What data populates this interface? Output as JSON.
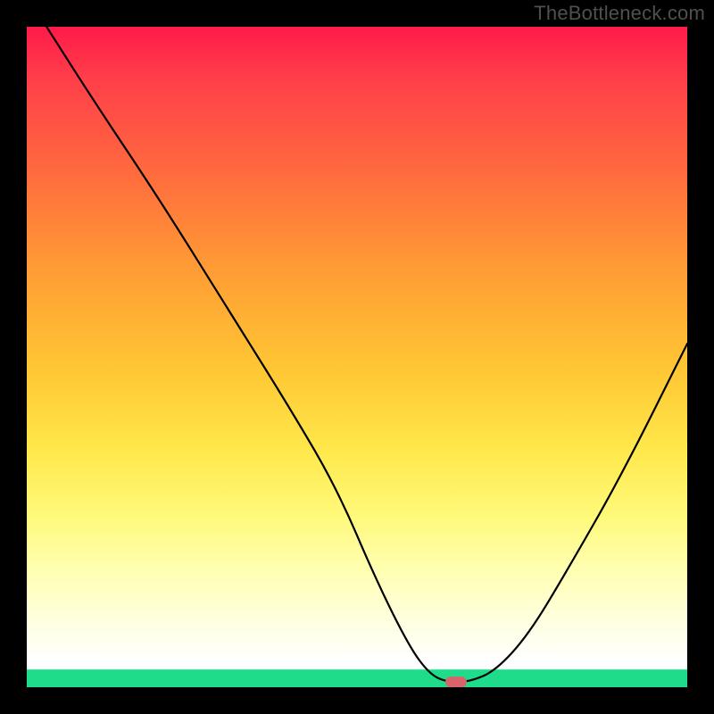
{
  "watermark": "TheBottleneck.com",
  "chart_data": {
    "type": "line",
    "title": "",
    "xlabel": "",
    "ylabel": "",
    "xlim": [
      0,
      100
    ],
    "ylim": [
      0,
      100
    ],
    "series": [
      {
        "name": "bottleneck-curve",
        "x": [
          3,
          10,
          20,
          30,
          40,
          47,
          53,
          58,
          61,
          63.5,
          67,
          71,
          76,
          82,
          90,
          100
        ],
        "y": [
          100,
          89,
          74,
          58,
          42,
          30,
          16,
          6,
          2,
          0.8,
          0.8,
          2.5,
          8,
          18,
          32,
          52
        ]
      }
    ],
    "marker": {
      "x": 65,
      "y": 0.8,
      "color": "#d9636b"
    },
    "gradient_stops": [
      {
        "pct": 0,
        "color": "#ff1a4a"
      },
      {
        "pct": 50,
        "color": "#ffd040"
      },
      {
        "pct": 93,
        "color": "#ffffff"
      },
      {
        "pct": 97.5,
        "color": "#1fdc8a"
      },
      {
        "pct": 100,
        "color": "#1fdc8a"
      }
    ]
  }
}
